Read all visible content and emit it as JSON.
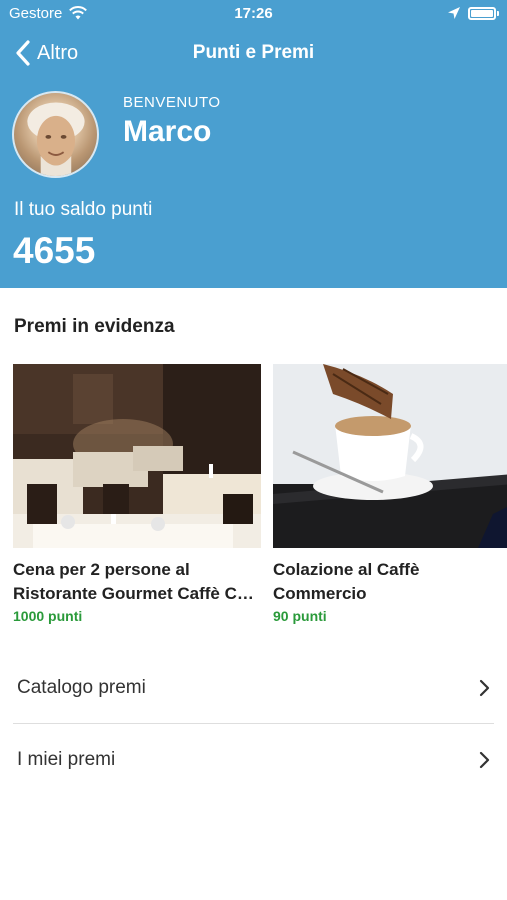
{
  "status_bar": {
    "carrier": "Gestore",
    "time": "17:26",
    "icons": [
      "wifi-icon",
      "location-arrow-icon",
      "battery-icon"
    ]
  },
  "nav": {
    "back_label": "Altro",
    "title": "Punti e Premi"
  },
  "profile": {
    "welcome": "BENVENUTO",
    "name": "Marco",
    "balance_label": "Il tuo saldo punti",
    "balance_value": "4655"
  },
  "featured": {
    "title": "Premi in evidenza",
    "items": [
      {
        "title_line1": "Cena per 2 persone al",
        "title_line2": "Ristorante Gourmet Caffè Commercio",
        "points": "1000 punti",
        "image": "restaurant-dining-room"
      },
      {
        "title_line1": "Colazione al Caffè",
        "title_line2": "Commercio",
        "points": "90 punti",
        "image": "cappuccino-and-croissant"
      }
    ]
  },
  "menu": [
    {
      "label": "Catalogo premi"
    },
    {
      "label": "I miei premi"
    }
  ],
  "colors": {
    "header_bg": "#4a9fd0",
    "points_green": "#2a9a3a"
  }
}
